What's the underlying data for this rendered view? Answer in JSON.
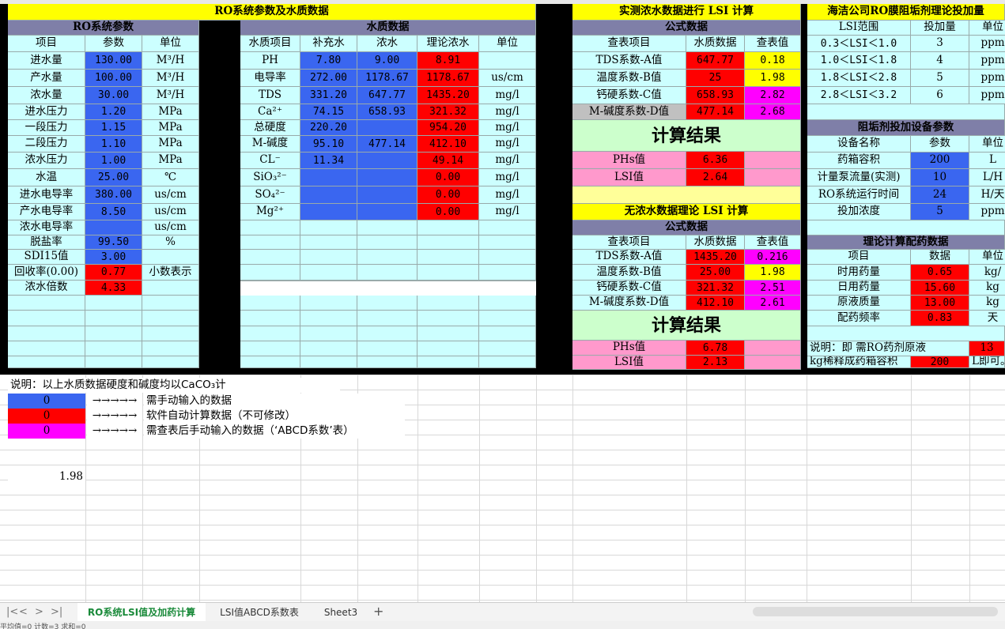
{
  "title_main": "RO系统参数及水质数据",
  "title_lsi": "实测浓水数据进行 LSI 计算",
  "title_dose": "海洁公司RO膜阻垢剂理论投加量",
  "ro_params": {
    "header": "RO系统参数",
    "cols": [
      "项目",
      "参数",
      "单位"
    ],
    "rows": [
      [
        "进水量",
        "130.00",
        "M³/H"
      ],
      [
        "产水量",
        "100.00",
        "M³/H"
      ],
      [
        "浓水量",
        "30.00",
        "M³/H"
      ],
      [
        "进水压力",
        "1.20",
        "MPa"
      ],
      [
        "一段压力",
        "1.15",
        "MPa"
      ],
      [
        "二段压力",
        "1.10",
        "MPa"
      ],
      [
        "浓水压力",
        "1.00",
        "MPa"
      ],
      [
        "水温",
        "25.00",
        "℃"
      ],
      [
        "进水电导率",
        "380.00",
        "us/cm"
      ],
      [
        "产水电导率",
        "8.50",
        "us/cm"
      ],
      [
        "浓水电导率",
        "",
        "us/cm"
      ],
      [
        "脱盐率",
        "99.50",
        "%"
      ],
      [
        "SDI15值",
        "3.00",
        ""
      ],
      [
        "回收率(0.00)",
        "0.77",
        "小数表示"
      ],
      [
        "浓水倍数",
        "4.33",
        ""
      ]
    ]
  },
  "water": {
    "header": "水质数据",
    "cols": [
      "水质项目",
      "补充水",
      "浓水",
      "理论浓水",
      "单位"
    ],
    "rows": [
      [
        "PH",
        "7.80",
        "9.00",
        "8.91",
        ""
      ],
      [
        "电导率",
        "272.00",
        "1178.67",
        "1178.67",
        "us/cm"
      ],
      [
        "TDS",
        "331.20",
        "647.77",
        "1435.20",
        "mg/l"
      ],
      [
        "Ca²⁺",
        "74.15",
        "658.93",
        "321.32",
        "mg/l"
      ],
      [
        "总硬度",
        "220.20",
        "",
        "954.20",
        "mg/l"
      ],
      [
        "M-碱度",
        "95.10",
        "477.14",
        "412.10",
        "mg/l"
      ],
      [
        "CL⁻",
        "11.34",
        "",
        "49.14",
        "mg/l"
      ],
      [
        "SiO₃²⁻",
        "",
        "",
        "0.00",
        "mg/l"
      ],
      [
        "SO₄²⁻",
        "",
        "",
        "0.00",
        "mg/l"
      ],
      [
        "Mg²⁺",
        "",
        "",
        "0.00",
        "mg/l"
      ]
    ]
  },
  "lsi1": {
    "subheader": "公式数据",
    "cols": [
      "查表项目",
      "水质数据",
      "查表值"
    ],
    "rows": [
      [
        "TDS系数-A值",
        "647.77",
        "0.18"
      ],
      [
        "温度系数-B值",
        "25",
        "1.98"
      ],
      [
        "钙硬系数-C值",
        "658.93",
        "2.82"
      ],
      [
        "M-碱度系数-D值",
        "477.14",
        "2.68"
      ]
    ],
    "result_title": "计算结果",
    "results": [
      [
        "PHs值",
        "6.36",
        ""
      ],
      [
        "LSI值",
        "2.64",
        ""
      ]
    ]
  },
  "lsi2": {
    "title": "无浓水数据理论 LSI 计算",
    "subheader": "公式数据",
    "cols": [
      "查表项目",
      "水质数据",
      "查表值"
    ],
    "rows": [
      [
        "TDS系数-A值",
        "1435.20",
        "0.216"
      ],
      [
        "温度系数-B值",
        "25.00",
        "1.98"
      ],
      [
        "钙硬系数-C值",
        "321.32",
        "2.51"
      ],
      [
        "M-碱度系数-D值",
        "412.10",
        "2.61"
      ]
    ],
    "result_title": "计算结果",
    "results": [
      [
        "PHs值",
        "6.78",
        ""
      ],
      [
        "LSI值",
        "2.13",
        ""
      ]
    ]
  },
  "dose": {
    "cols": [
      "LSI范围",
      "投加量",
      "单位"
    ],
    "rows": [
      [
        "0.3＜LSI＜1.0",
        "3",
        "ppm"
      ],
      [
        "1.0＜LSI＜1.8",
        "4",
        "ppm"
      ],
      [
        "1.8＜LSI＜2.8",
        "5",
        "ppm"
      ],
      [
        "2.8＜LSI＜3.2",
        "6",
        "ppm"
      ]
    ],
    "equip_header": "阻垢剂投加设备参数",
    "equip_cols": [
      "设备名称",
      "参数",
      "单位"
    ],
    "equip_rows": [
      [
        "药箱容积",
        "200",
        "L"
      ],
      [
        "计量泵流量(实测)",
        "10",
        "L/H"
      ],
      [
        "RO系统运行时间",
        "24",
        "H/天"
      ],
      [
        "投加浓度",
        "5",
        "ppm"
      ]
    ],
    "calc_header": "理论计算配药数据",
    "calc_cols": [
      "项目",
      "数据",
      "单位"
    ],
    "calc_rows": [
      [
        "时用药量",
        "0.65",
        "kg/"
      ],
      [
        "日用药量",
        "15.60",
        "kg"
      ],
      [
        "原液质量",
        "13.00",
        "kg"
      ],
      [
        "配药频率",
        "0.83",
        "天"
      ]
    ],
    "note1": "说明：即    需RO药剂原液",
    "note1_val": "13",
    "note2": "kg稀释成药箱容积",
    "note2_val": "200",
    "note3": "L即可。"
  },
  "legend": {
    "note": "说明：以上水质数据硬度和碱度均以CaCO₃计",
    "arrows": "→→→→→",
    "items": [
      {
        "value": "0",
        "text": "需手动输入的数据",
        "color": "#3a66f0"
      },
      {
        "value": "0",
        "text": "软件自动计算数据（不可修改）",
        "color": "#ff0000"
      },
      {
        "value": "0",
        "text": "需查表后手动输入的数据（‘ABCD系数’表）",
        "color": "#ff00ff"
      }
    ]
  },
  "stray_value": "1.98",
  "tabs": [
    "RO系统LSI值及加药计算",
    "LSI值ABCD系数表",
    "Sheet3"
  ],
  "nav": {
    "first": "|<",
    "prev": "<",
    "next": ">",
    "last": ">|",
    "add": "+"
  },
  "status": "平均值=0  计数=3  求和=0"
}
